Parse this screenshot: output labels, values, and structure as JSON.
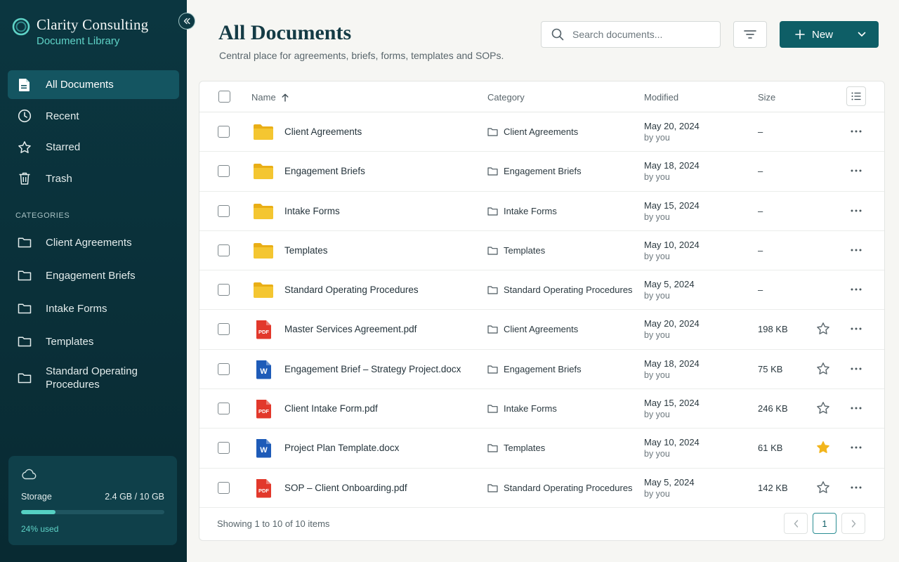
{
  "brand": {
    "title": "Clarity Consulting",
    "subtitle": "Document Library",
    "accent": "#5fd3c7"
  },
  "nav": [
    {
      "label": "All Documents",
      "icon": "file-icon",
      "active": true
    },
    {
      "label": "Recent",
      "icon": "clock-icon"
    },
    {
      "label": "Starred",
      "icon": "star-icon"
    },
    {
      "label": "Trash",
      "icon": "trash-icon"
    }
  ],
  "categories_heading": "CATEGORIES",
  "categories": [
    {
      "label": "Client Agreements"
    },
    {
      "label": "Engagement Briefs"
    },
    {
      "label": "Intake Forms"
    },
    {
      "label": "Templates"
    },
    {
      "label": "Standard Operating Procedures"
    }
  ],
  "storage": {
    "label": "Storage",
    "usage": "2.4 GB / 10 GB",
    "used_text": "24% used",
    "used_fraction": 0.24
  },
  "header": {
    "title": "All Documents",
    "subtitle": "Central place for agreements, briefs, forms, templates and SOPs.",
    "search_placeholder": "Search documents...",
    "new_label": "New"
  },
  "table": {
    "columns": {
      "name": "Name",
      "category": "Category",
      "modified": "Modified",
      "size": "Size"
    },
    "rows": [
      {
        "type": "folder",
        "name": "Client Agreements",
        "category": "Client Agreements",
        "date": "May 20, 2024",
        "by": "by you",
        "size": "–"
      },
      {
        "type": "folder",
        "name": "Engagement Briefs",
        "category": "Engagement Briefs",
        "date": "May 18, 2024",
        "by": "by you",
        "size": "–"
      },
      {
        "type": "folder",
        "name": "Intake Forms",
        "category": "Intake Forms",
        "date": "May 15, 2024",
        "by": "by you",
        "size": "–"
      },
      {
        "type": "folder",
        "name": "Templates",
        "category": "Templates",
        "date": "May 10, 2024",
        "by": "by you",
        "size": "–"
      },
      {
        "type": "folder",
        "name": "Standard Operating Procedures",
        "category": "Standard Operating Procedures",
        "date": "May 5, 2024",
        "by": "by you",
        "size": "–"
      },
      {
        "type": "pdf",
        "name": "Master Services Agreement.pdf",
        "category": "Client Agreements",
        "date": "May 20, 2024",
        "by": "by you",
        "size": "198 KB",
        "starred": false
      },
      {
        "type": "word",
        "name": "Engagement Brief – Strategy Project.docx",
        "category": "Engagement Briefs",
        "date": "May 18, 2024",
        "by": "by you",
        "size": "75 KB",
        "starred": false
      },
      {
        "type": "pdf",
        "name": "Client Intake Form.pdf",
        "category": "Intake Forms",
        "date": "May 15, 2024",
        "by": "by you",
        "size": "246 KB",
        "starred": false
      },
      {
        "type": "word",
        "name": "Project Plan Template.docx",
        "category": "Templates",
        "date": "May 10, 2024",
        "by": "by you",
        "size": "61 KB",
        "starred": true
      },
      {
        "type": "pdf",
        "name": "SOP – Client Onboarding.pdf",
        "category": "Standard Operating Procedures",
        "date": "May 5, 2024",
        "by": "by you",
        "size": "142 KB",
        "starred": false
      }
    ]
  },
  "footer": {
    "summary": "Showing 1 to 10 of 10 items",
    "current_page": "1"
  },
  "icons": {
    "pdf_badge": "PDF",
    "word_badge": "W"
  },
  "colors": {
    "sidebar": "#0b3640",
    "primary": "#0e5e66",
    "folder": "#f2c230",
    "pdf": "#e2382b",
    "word": "#1e5bb8",
    "star_active": "#f2b51c"
  }
}
